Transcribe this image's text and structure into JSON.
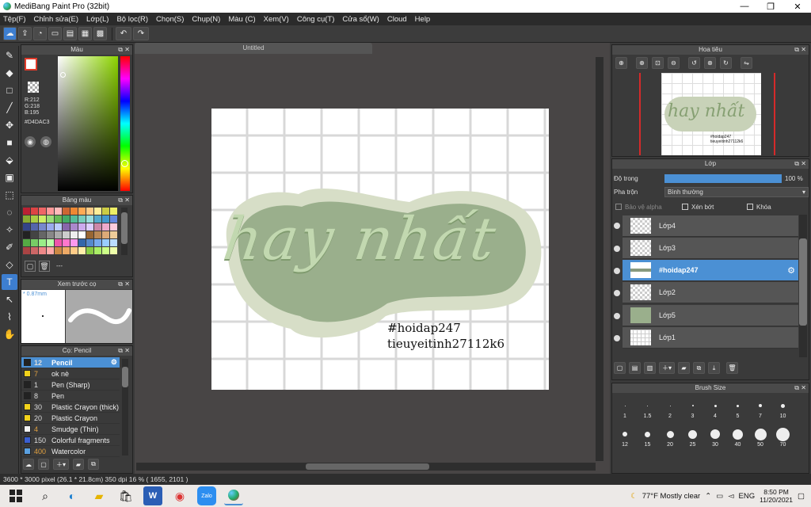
{
  "window": {
    "title": "MediBang Paint Pro (32bit)",
    "minimize": "—",
    "maximize": "❐",
    "close": "✕"
  },
  "menu": [
    "Tệp(F)",
    "Chỉnh sửa(E)",
    "Lớp(L)",
    "Bộ lọc(R)",
    "Chọn(S)",
    "Chụp(N)",
    "Màu (C)",
    "Xem(V)",
    "Công cụ(T)",
    "Cửa sổ(W)",
    "Cloud",
    "Help"
  ],
  "toolbar": {
    "undo": "↶",
    "redo": "↷"
  },
  "color_panel": {
    "title": "Màu",
    "rgb_r": "R:212",
    "rgb_g": "G:218",
    "rgb_b": "B:195",
    "hex": "#D4DAC3"
  },
  "palette_panel": {
    "title": "Bảng màu",
    "dash": "---"
  },
  "preview_panel": {
    "title": "Xem trước cọ",
    "size": "* 0.87mm"
  },
  "brush_panel": {
    "title": "Cọ: Pencil",
    "items": [
      {
        "num": "12",
        "name": "Pencil",
        "color": "#222222"
      },
      {
        "num": "7",
        "name": "ok nè",
        "color": "#f2d21b"
      },
      {
        "num": "1",
        "name": "Pen (Sharp)",
        "color": "#222222"
      },
      {
        "num": "8",
        "name": "Pen",
        "color": "#222222"
      },
      {
        "num": "30",
        "name": "Plastic Crayon (thick)",
        "color": "#f2d21b"
      },
      {
        "num": "20",
        "name": "Plastic Crayon",
        "color": "#f2d21b"
      },
      {
        "num": "4",
        "name": "Smudge (Thin)",
        "color": "#f2f2f2"
      },
      {
        "num": "150",
        "name": "Colorful fragments",
        "color": "#3a5fd0"
      },
      {
        "num": "400",
        "name": "Watercolor",
        "color": "#5aa0e0"
      }
    ]
  },
  "document": {
    "tab": "Untitled"
  },
  "artwork": {
    "main_text": "hay nhất",
    "tag_line": "#hoidap247",
    "sig_line": "tieuyeitinh27112k6"
  },
  "navigator": {
    "title": "Hoa tiêu"
  },
  "layer_panel": {
    "title": "Lớp",
    "opacity_label": "Độ trong",
    "opacity_value": "100 %",
    "opacity_fraction": 1.0,
    "blend_label": "Pha trộn",
    "blend_value": "Bình thường",
    "protect_alpha": "Bảo vệ alpha",
    "clip": "Xén bớt",
    "lock": "Khóa",
    "layers": [
      {
        "name": "Lớp4",
        "selected": false
      },
      {
        "name": "Lớp3",
        "selected": false
      },
      {
        "name": "#hoidap247",
        "selected": true
      },
      {
        "name": "Lớp2",
        "selected": false
      },
      {
        "name": "Lớp5",
        "selected": false
      },
      {
        "name": "Lớp1",
        "selected": false
      }
    ]
  },
  "brush_size_panel": {
    "title": "Brush Size",
    "sizes": [
      "1",
      "1.5",
      "2",
      "3",
      "4",
      "5",
      "7",
      "10",
      "12",
      "15",
      "20",
      "25",
      "30",
      "40",
      "50",
      "70"
    ]
  },
  "status": {
    "text": "3600 * 3000 pixel   (26.1 * 21.8cm)   350 dpi   16 %   ( 1655, 2101 )"
  },
  "taskbar": {
    "weather": "77°F  Mostly clear",
    "lang": "ENG",
    "time": "8:50 PM",
    "date": "11/20/2021"
  },
  "colors": {
    "accent": "#4b90d4",
    "lettering": "#8aa37a",
    "sticker_bg": "#d7dec7",
    "sticker_mid": "#9aaf8c"
  }
}
